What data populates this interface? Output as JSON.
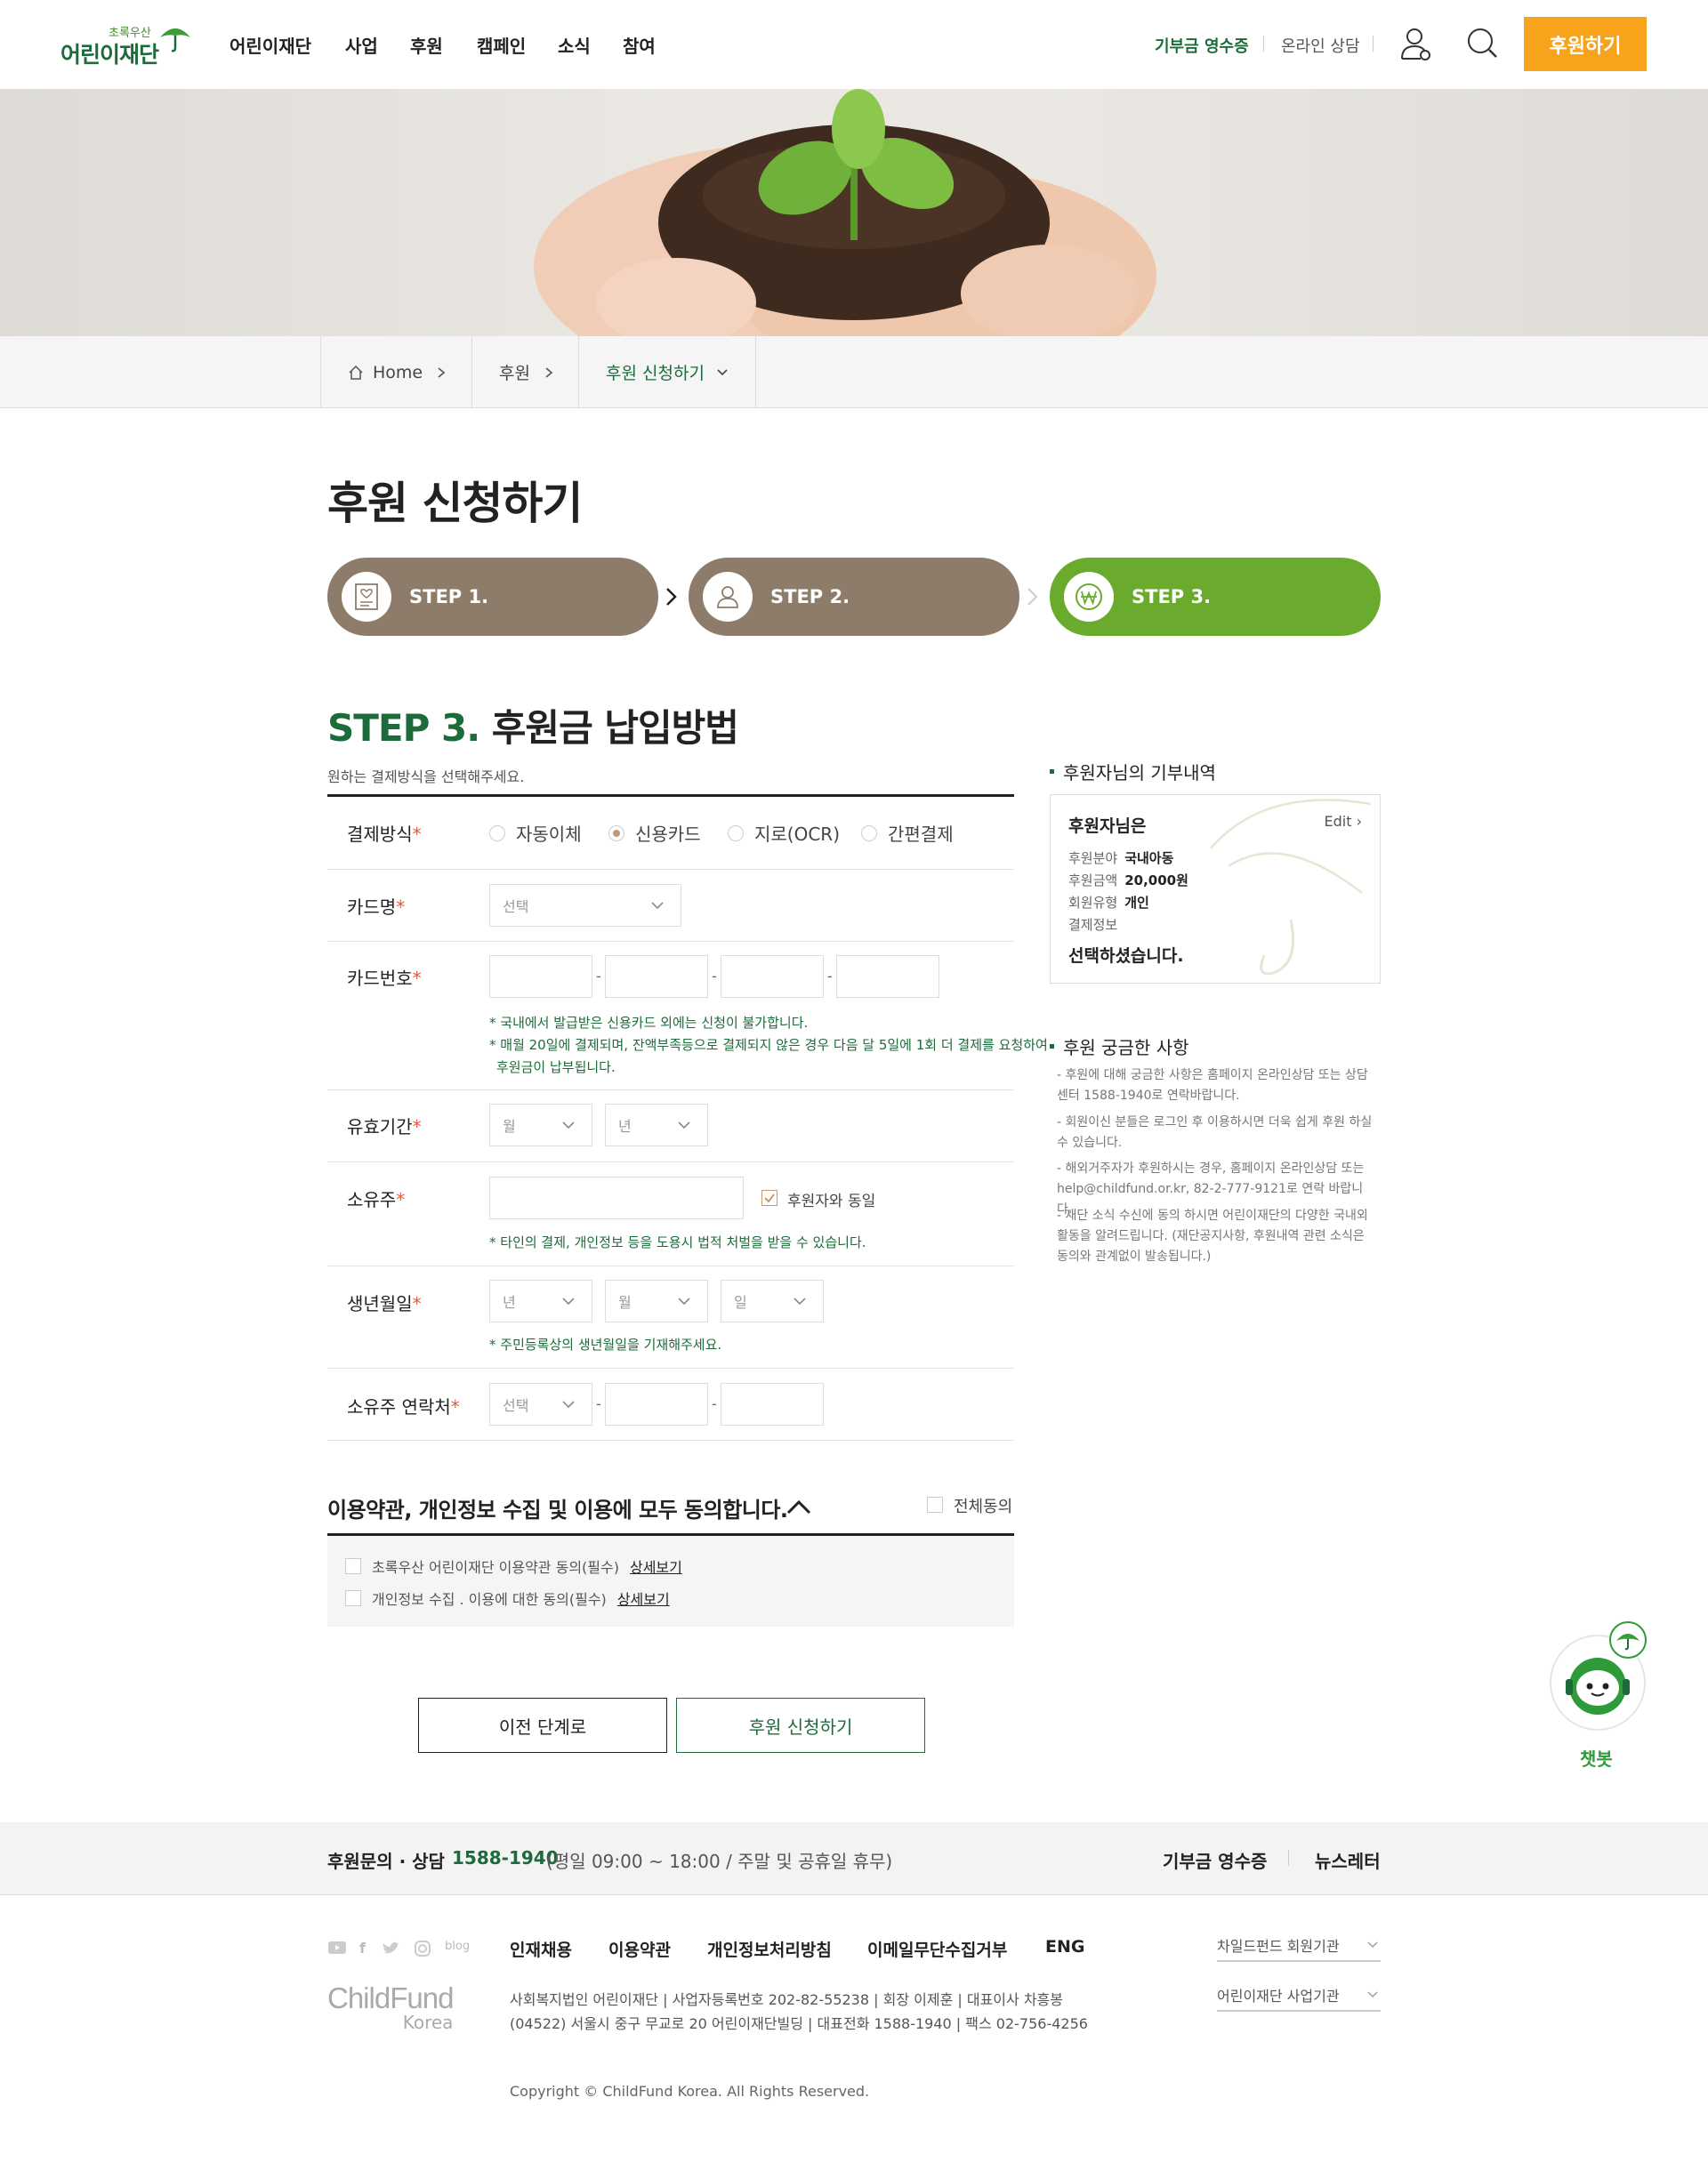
{
  "header": {
    "logo_small": "초록우산",
    "logo_big": "어린이재단",
    "nav": [
      "어린이재단",
      "사업",
      "후원",
      "캠페인",
      "소식",
      "참여"
    ],
    "util_receipt": "기부금 영수증",
    "util_consult": "온라인 상담",
    "donate_button": "후원하기"
  },
  "breadcrumb": {
    "home": "Home",
    "level1": "후원",
    "level2": "후원 신청하기"
  },
  "page_title": "후원 신청하기",
  "steps": [
    {
      "label": "STEP 1.",
      "icon": "document-heart-icon",
      "active": false
    },
    {
      "label": "STEP 2.",
      "icon": "person-icon",
      "active": false
    },
    {
      "label": "STEP 3.",
      "icon": "won-icon",
      "active": true
    }
  ],
  "colors": {
    "accent_green": "#1c6b3a",
    "step_brown": "#8e7c6a",
    "step_active": "#6aab2e",
    "donate_orange": "#f7a31b"
  },
  "step3": {
    "head_prefix": "STEP 3.",
    "head_text": " 후원금 납입방법",
    "subtitle": "원하는 결제방식을 선택해주세요."
  },
  "form": {
    "payment_method": {
      "label": "결제방식",
      "options": [
        "자동이체",
        "신용카드",
        "지로(OCR)",
        "간편결제"
      ],
      "selected": "신용카드"
    },
    "card_name": {
      "label": "카드명",
      "placeholder": "선택"
    },
    "card_number": {
      "label": "카드번호",
      "notes": [
        "* 국내에서 발급받은 신용카드 외에는 신청이 불가합니다.",
        "* 매월 20일에 결제되며, 잔액부족등으로 결제되지 않은 경우 다음 달 5일에 1회 더 결제를 요청하여",
        "후원금이 납부됩니다."
      ]
    },
    "expiry": {
      "label": "유효기간",
      "month": "월",
      "year": "년"
    },
    "owner": {
      "label": "소유주",
      "same_as_donor": "후원자와 동일",
      "note": "* 타인의 결제, 개인정보 등을 도용시 법적 처벌을 받을 수 있습니다."
    },
    "birth": {
      "label": "생년월일",
      "year": "년",
      "month": "월",
      "day": "일",
      "note": "* 주민등록상의 생년월일을 기재해주세요."
    },
    "owner_phone": {
      "label": "소유주 연락처",
      "placeholder": "선택"
    }
  },
  "terms": {
    "title": "이용약관, 개인정보 수집 및 이용에 모두 동의합니다.",
    "agree_all": "전체동의",
    "items": [
      {
        "text": "초록우산 어린이재단 이용약관 동의(필수)",
        "more": "상세보기"
      },
      {
        "text": "개인정보 수집 . 이용에 대한 동의(필수)",
        "more": "상세보기"
      }
    ]
  },
  "buttons": {
    "prev": "이전 단계로",
    "submit": "후원 신청하기"
  },
  "sidebar": {
    "summary_title": "후원자님의 기부내역",
    "donor": "후원자님은",
    "edit": "Edit",
    "rows": [
      {
        "k": "후원분야",
        "v": "국내아동"
      },
      {
        "k": "후원금액",
        "v": "20,000원"
      },
      {
        "k": "회원유형",
        "v": "개인"
      },
      {
        "k": "결제정보",
        "v": ""
      }
    ],
    "done": "선택하셨습니다.",
    "faq_title": "후원 궁금한 사항",
    "faq": [
      "- 후원에 대해 궁금한 사항은 홈페이지 온라인상담 또는 상담 센터 1588-1940로 연락바랍니다.",
      "- 회원이신 분들은 로그인 후 이용하시면 더욱 쉽게 후원 하실 수 있습니다.",
      "- 해외거주자가 후원하시는 경우, 홈페이지 온라인상담 또는 help@childfund.or.kr, 82-2-777-9121로 연락 바랍니다.",
      "- 재단 소식 수신에 동의 하시면 어린이재단의 다양한 국내외 활동을 알려드립니다. (재단공지사항, 후원내역 관련 소식은 동의와 관계없이 발송됩니다.)"
    ]
  },
  "chatbot": {
    "label": "챗봇"
  },
  "footer": {
    "contact_label": "후원문의 · 상담",
    "contact_phone": "1588-1940",
    "contact_hours": "(평일 09:00 ~ 18:00 / 주말 및 공휴일 휴무)",
    "receipt": "기부금 영수증",
    "newsletter": "뉴스레터",
    "links": [
      "인재채용",
      "이용약관",
      "개인정보처리방침",
      "이메일무단수집거부",
      "ENG"
    ],
    "social_blog": "blog",
    "logo_text": "ChildFund",
    "logo_sub": "Korea",
    "address1": "사회복지법인 어린이재단 | 사업자등록번호 202-82-55238 | 회장 이제훈 | 대표이사 차흥봉",
    "address2": "(04522) 서울시 중구 무교로 20 어린이재단빌딩 | 대표전화 1588-1940 | 팩스 02-756-4256",
    "select1": "차일드펀드 회원기관",
    "select2": "어린이재단 사업기관",
    "copyright": "Copyright © ChildFund Korea. All Rights Reserved."
  }
}
